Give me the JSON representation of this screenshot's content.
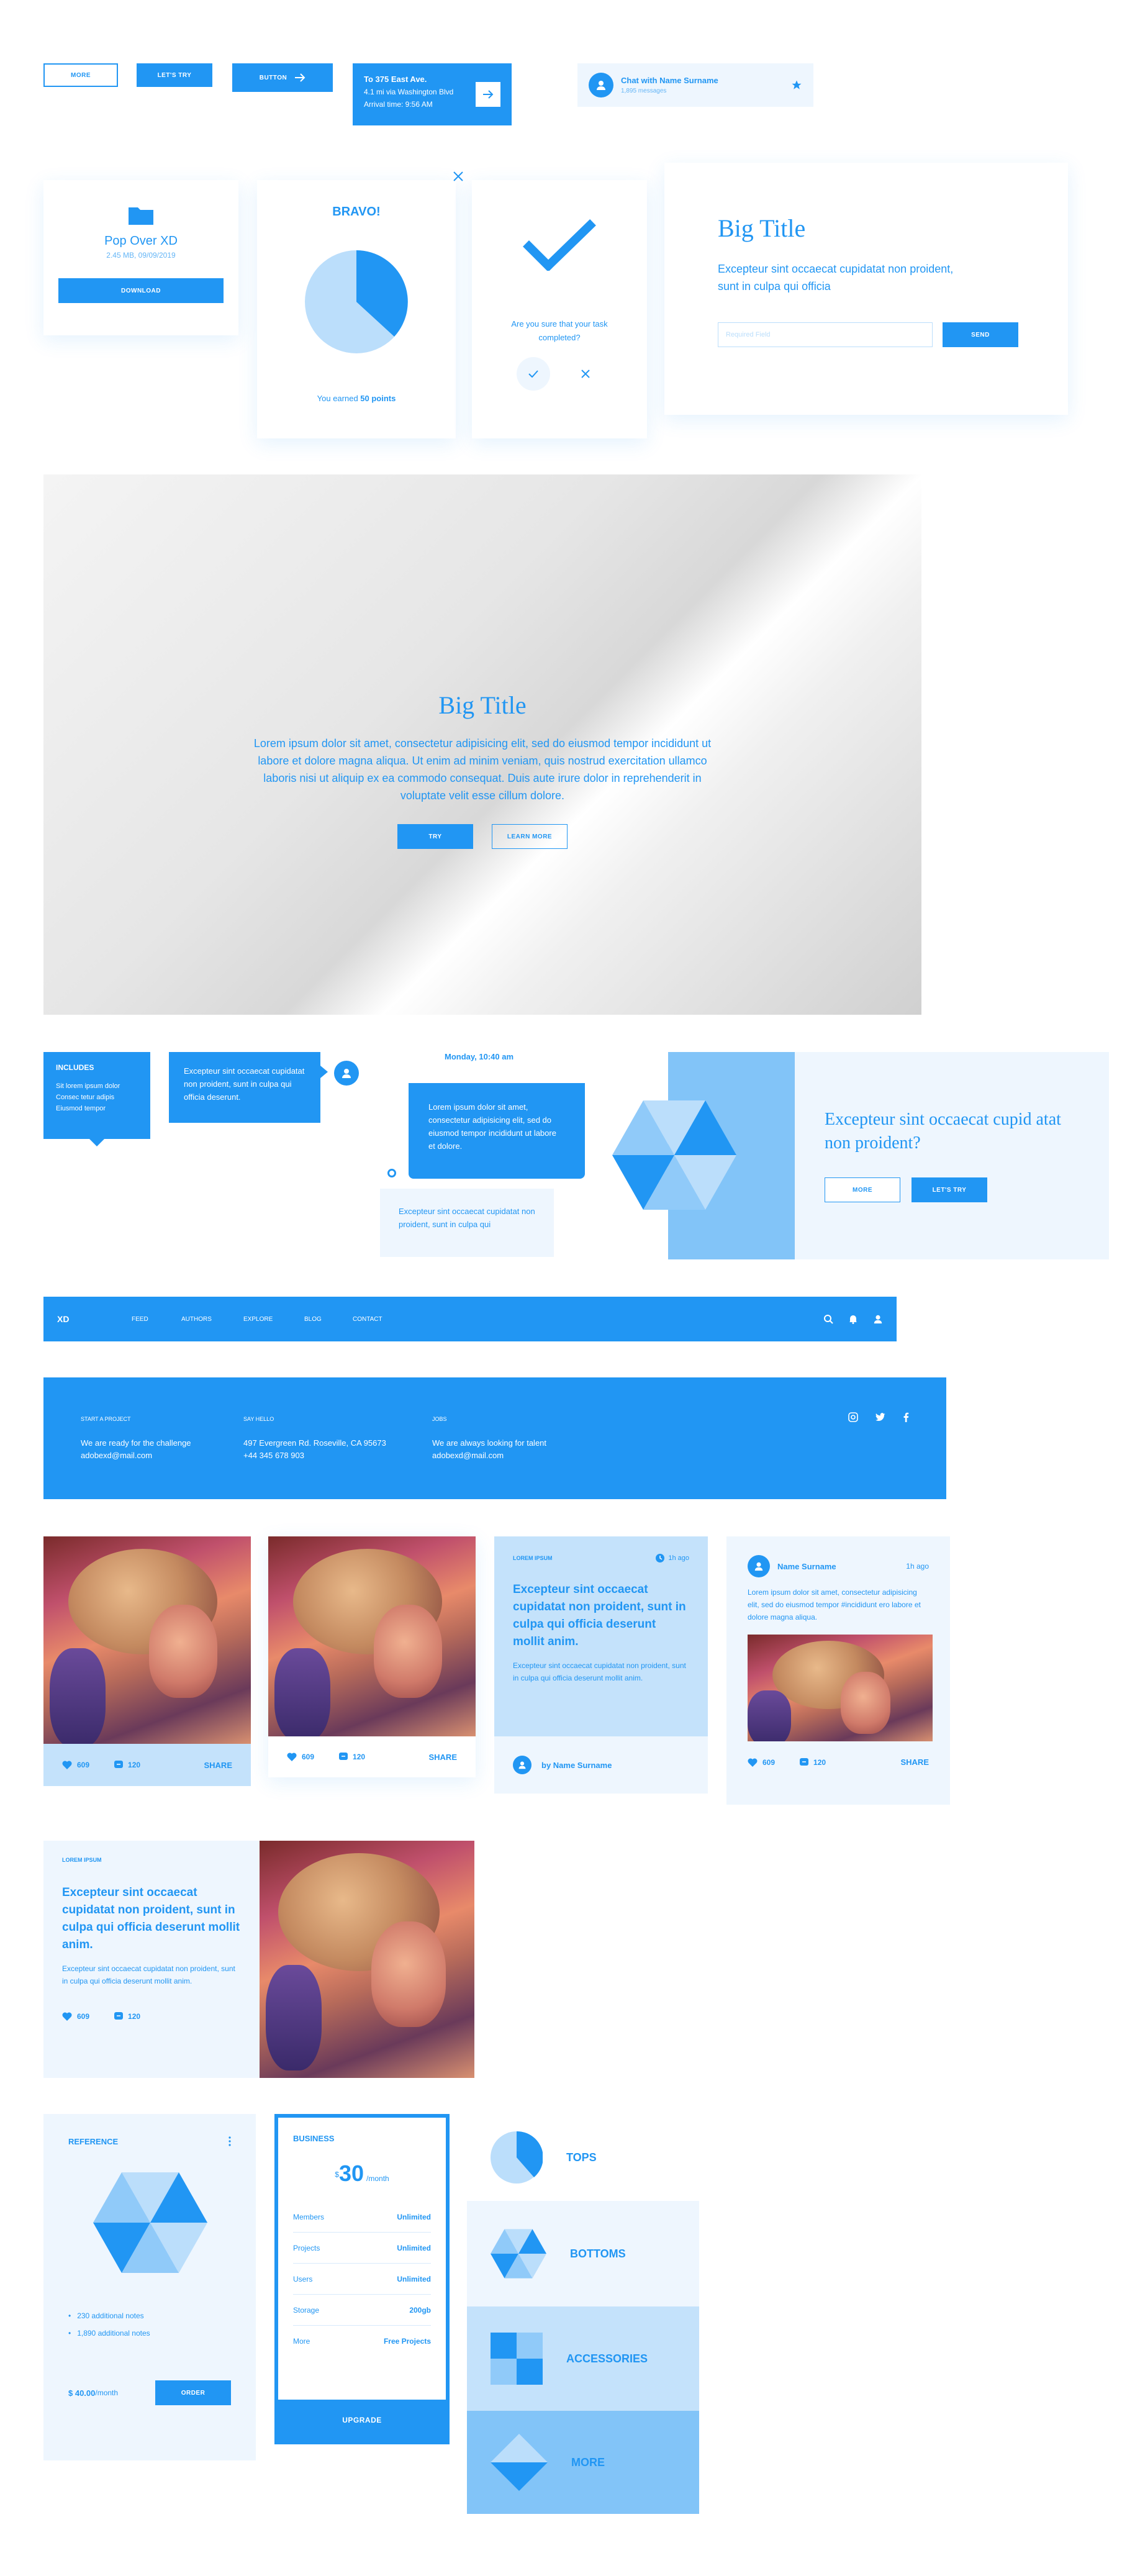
{
  "buttons_row": {
    "more": "MORE",
    "lets_try": "LET'S TRY",
    "button": "BUTTON",
    "directions": {
      "title": "To 375 East Ave.",
      "via": "4.1 mi via Washington Blvd",
      "arrival": "Arrival time: 9:56 AM"
    },
    "chat": {
      "name": "Chat with Name Surname",
      "sub": "1,895 messages"
    }
  },
  "popover": {
    "title": "Pop Over XD",
    "meta": "2.45 MB, 09/09/2019",
    "button": "DOWNLOAD"
  },
  "bravo": {
    "title": "BRAVO!",
    "text_prefix": "You earned ",
    "points": "50 points"
  },
  "confirm": {
    "text": "Are you sure that your task completed?"
  },
  "big_card": {
    "title": "Big Title",
    "text": "Excepteur sint occaecat cupidatat non proident, sunt in culpa qui officia",
    "placeholder": "Required Field",
    "send": "SEND"
  },
  "hero": {
    "title": "Big Title",
    "text": "Lorem ipsum dolor sit amet, consectetur adipisicing elit, sed do eiusmod tempor incididunt ut labore et dolore magna aliqua. Ut enim ad minim veniam, quis nostrud exercitation ullamco laboris nisi ut aliquip ex ea commodo consequat. Duis aute irure dolor in reprehenderit in voluptate velit esse cillum dolore.",
    "try": "TRY",
    "learn": "LEARN MORE"
  },
  "includes": {
    "title": "INCLUDES",
    "items": [
      "Sit lorem ipsum dolor",
      "Consec tetur adipis",
      "Eiusmod tempor"
    ]
  },
  "bubble1": "Excepteur sint occaecat cupidatat non proident, sunt in culpa qui officia deserunt.",
  "chat_time": "Monday, 10:40 am",
  "bubble2": "Lorem ipsum dolor sit amet, consectetur adipisicing elit, sed do eiusmod tempor incididunt ut labore et dolore.",
  "bubble3": "Excepteur sint occaecat cupidatat non proident, sunt in culpa qui",
  "promo": {
    "title": "Excepteur sint occaecat cupid atat non proident?",
    "more": "MORE",
    "try": "LET'S TRY"
  },
  "navbar": {
    "logo": "XD",
    "items": [
      "FEED",
      "AUTHORS",
      "EXPLORE",
      "BLOG",
      "CONTACT"
    ]
  },
  "footer": {
    "cols": [
      {
        "label": "START A PROJECT",
        "l1": "We are ready for the challenge",
        "l2": "adobexd@mail.com"
      },
      {
        "label": "SAY HELLO",
        "l1": "497 Evergreen Rd. Roseville, CA 95673",
        "l2": "+44 345 678 903"
      },
      {
        "label": "JOBS",
        "l1": "We are always looking for talent",
        "l2": "adobexd@mail.com"
      }
    ]
  },
  "cards": {
    "likes": "609",
    "comments": "120",
    "share": "SHARE",
    "text_card": {
      "tag": "LOREM IPSUM",
      "time": "1h ago",
      "heading": "Excepteur sint occaecat cupidatat non proident, sunt in culpa qui officia deserunt mollit anim.",
      "body": "Excepteur sint occaecat cupidatat non proident, sunt in culpa qui officia deserunt mollit anim.",
      "by": "by Name Surname"
    },
    "post": {
      "name": "Name Surname",
      "time": "1h ago",
      "body": "Lorem ipsum dolor sit amet, consectetur adipisicing elit, sed do eiusmod tempor #incididunt ero labore et dolore magna aliqua."
    }
  },
  "wide_card": {
    "tag": "LOREM IPSUM",
    "heading": "Excepteur sint occaecat cupidatat non proident, sunt in culpa qui officia deserunt mollit anim.",
    "body": "Excepteur sint occaecat cupidatat non proident, sunt in culpa qui officia deserunt mollit anim.",
    "likes": "609",
    "comments": "120"
  },
  "reference": {
    "title": "REFERENCE",
    "notes": [
      "230 additional notes",
      "1,890 additional notes"
    ],
    "price": "$ 40.00",
    "per": " /month",
    "order": "ORDER"
  },
  "pricing": {
    "plan": "BUSINESS",
    "currency": "$",
    "amount": "30",
    "per": "/month",
    "rows": [
      {
        "k": "Members",
        "v": "Unlimited"
      },
      {
        "k": "Projects",
        "v": "Unlimited"
      },
      {
        "k": "Users",
        "v": "Unlimited"
      },
      {
        "k": "Storage",
        "v": "200gb"
      },
      {
        "k": "More",
        "v": "Free Projects"
      }
    ],
    "upgrade": "UPGRADE"
  },
  "categories": [
    "TOPS",
    "BOTTOMS",
    "ACCESSORIES",
    "MORE"
  ],
  "colors": {
    "primary": "#2196f3",
    "light": "#eef6fe",
    "mid": "#c4e2fb",
    "sky": "#82c4f8"
  }
}
